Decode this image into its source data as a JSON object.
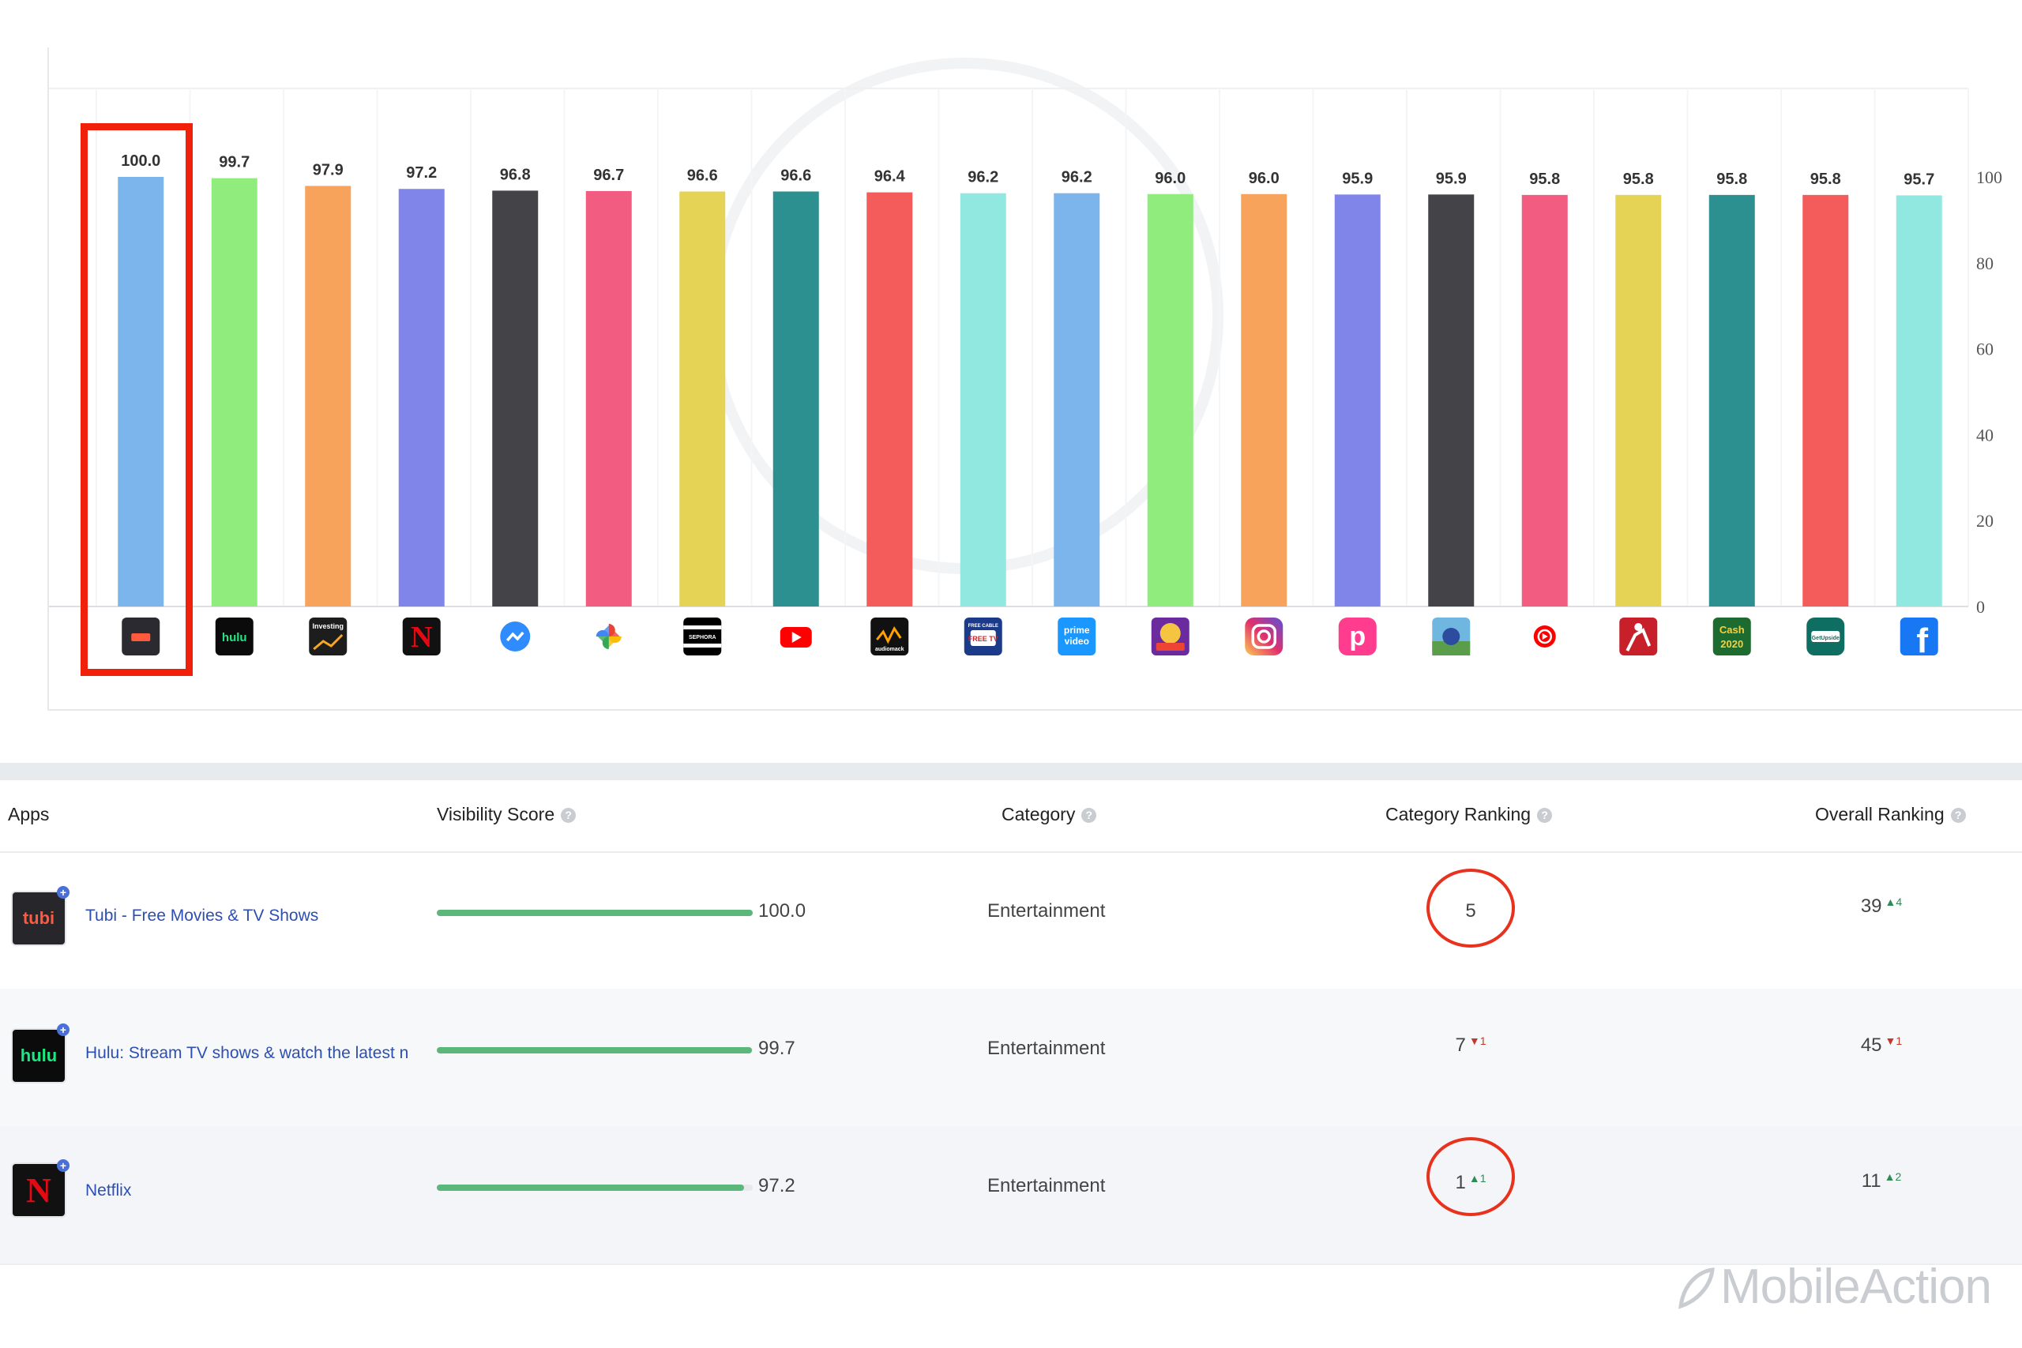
{
  "chart_data": {
    "type": "bar",
    "categories": [
      "Tubi",
      "Hulu",
      "Investing.com",
      "Netflix",
      "Messenger",
      "Google Photos",
      "Sephora",
      "YouTube",
      "Audiomack",
      "Free Cable TV",
      "Prime Video",
      "Slots Game",
      "Instagram",
      "Picsart",
      "Solitaire Game",
      "YouTube Music",
      "Fitness App",
      "Cash 2020",
      "GetUpside",
      "Facebook"
    ],
    "values": [
      100.0,
      99.7,
      97.9,
      97.2,
      96.8,
      96.7,
      96.6,
      96.6,
      96.4,
      96.2,
      96.2,
      96.0,
      96.0,
      95.9,
      95.9,
      95.8,
      95.8,
      95.8,
      95.8,
      95.7
    ],
    "value_labels": [
      "100.0",
      "99.7",
      "97.9",
      "97.2",
      "96.8",
      "96.7",
      "96.6",
      "96.6",
      "96.4",
      "96.2",
      "96.2",
      "96.0",
      "96.0",
      "95.9",
      "95.9",
      "95.8",
      "95.8",
      "95.8",
      "95.8",
      "95.7"
    ],
    "colors": [
      "#7cb5ec",
      "#90ed7d",
      "#f7a35c",
      "#8085e9",
      "#434348",
      "#f15c80",
      "#e4d354",
      "#2b908f",
      "#f45b5b",
      "#91e8e1",
      "#7cb5ec",
      "#90ed7d",
      "#f7a35c",
      "#8085e9",
      "#434348",
      "#f15c80",
      "#e4d354",
      "#2b908f",
      "#f45b5b",
      "#91e8e1"
    ],
    "icons": [
      "tubi-icon",
      "hulu-icon",
      "investing-icon",
      "netflix-icon",
      "messenger-icon",
      "pinwheel-icon",
      "sephora-icon",
      "youtube-icon",
      "audiomack-icon",
      "free-cable-tv-icon",
      "prime-video-icon",
      "slots-icon",
      "instagram-icon",
      "picsart-icon",
      "game-icon",
      "youtube-music-icon",
      "fitness-icon",
      "cash-2020-icon",
      "getupside-icon",
      "facebook-icon"
    ],
    "icon_texts": {
      "hulu-icon": "hulu",
      "investing-icon": "Investing",
      "netflix-icon": "N",
      "sephora-icon": "SEPHORA",
      "audiomack-icon": "audiomack",
      "free-cable-tv-icon": "FREE CABLE",
      "free-cable-tv-icon-2": "FREE TV",
      "prime-video-icon": "prime",
      "prime-video-icon-2": "video",
      "cash-2020-icon": "Cash",
      "cash-2020-icon-2": "2020",
      "getupside-icon": "GetUpside",
      "facebook-icon": "f",
      "picsart-icon": "p"
    },
    "ylim": [
      0,
      100
    ],
    "yticks": [
      "0",
      "20",
      "40",
      "60",
      "80",
      "100"
    ],
    "ytick_values": [
      0,
      20,
      40,
      60,
      80,
      100
    ],
    "highlighted_index": 0,
    "grid": true,
    "title": "",
    "xlabel": "",
    "ylabel": ""
  },
  "table": {
    "headers": {
      "apps": "Apps",
      "visibility": "Visibility Score",
      "category": "Category",
      "category_ranking": "Category Ranking",
      "overall_ranking": "Overall Ranking",
      "help": "?"
    },
    "rows": [
      {
        "name": "Tubi - Free Movies & TV Shows",
        "score": 100.0,
        "score_text": "100.0",
        "category": "Entertainment",
        "cat_rank": "5",
        "cat_change": "",
        "overall_rank": "39",
        "overall_change": "▲4",
        "icon_text": "tubi"
      },
      {
        "name": "Hulu: Stream TV shows & watch the latest n",
        "score": 99.7,
        "score_text": "99.7",
        "category": "Entertainment",
        "cat_rank": "7",
        "cat_change": "▼1",
        "overall_rank": "45",
        "overall_change": "▼1",
        "icon_text": "hulu"
      },
      {
        "name": "Netflix",
        "score": 97.2,
        "score_text": "97.2",
        "category": "Entertainment",
        "cat_rank": "1",
        "cat_change": "▲1",
        "overall_rank": "11",
        "overall_change": "▲2",
        "icon_text": "N"
      }
    ],
    "plus": "+"
  },
  "watermark": "MobileAction"
}
